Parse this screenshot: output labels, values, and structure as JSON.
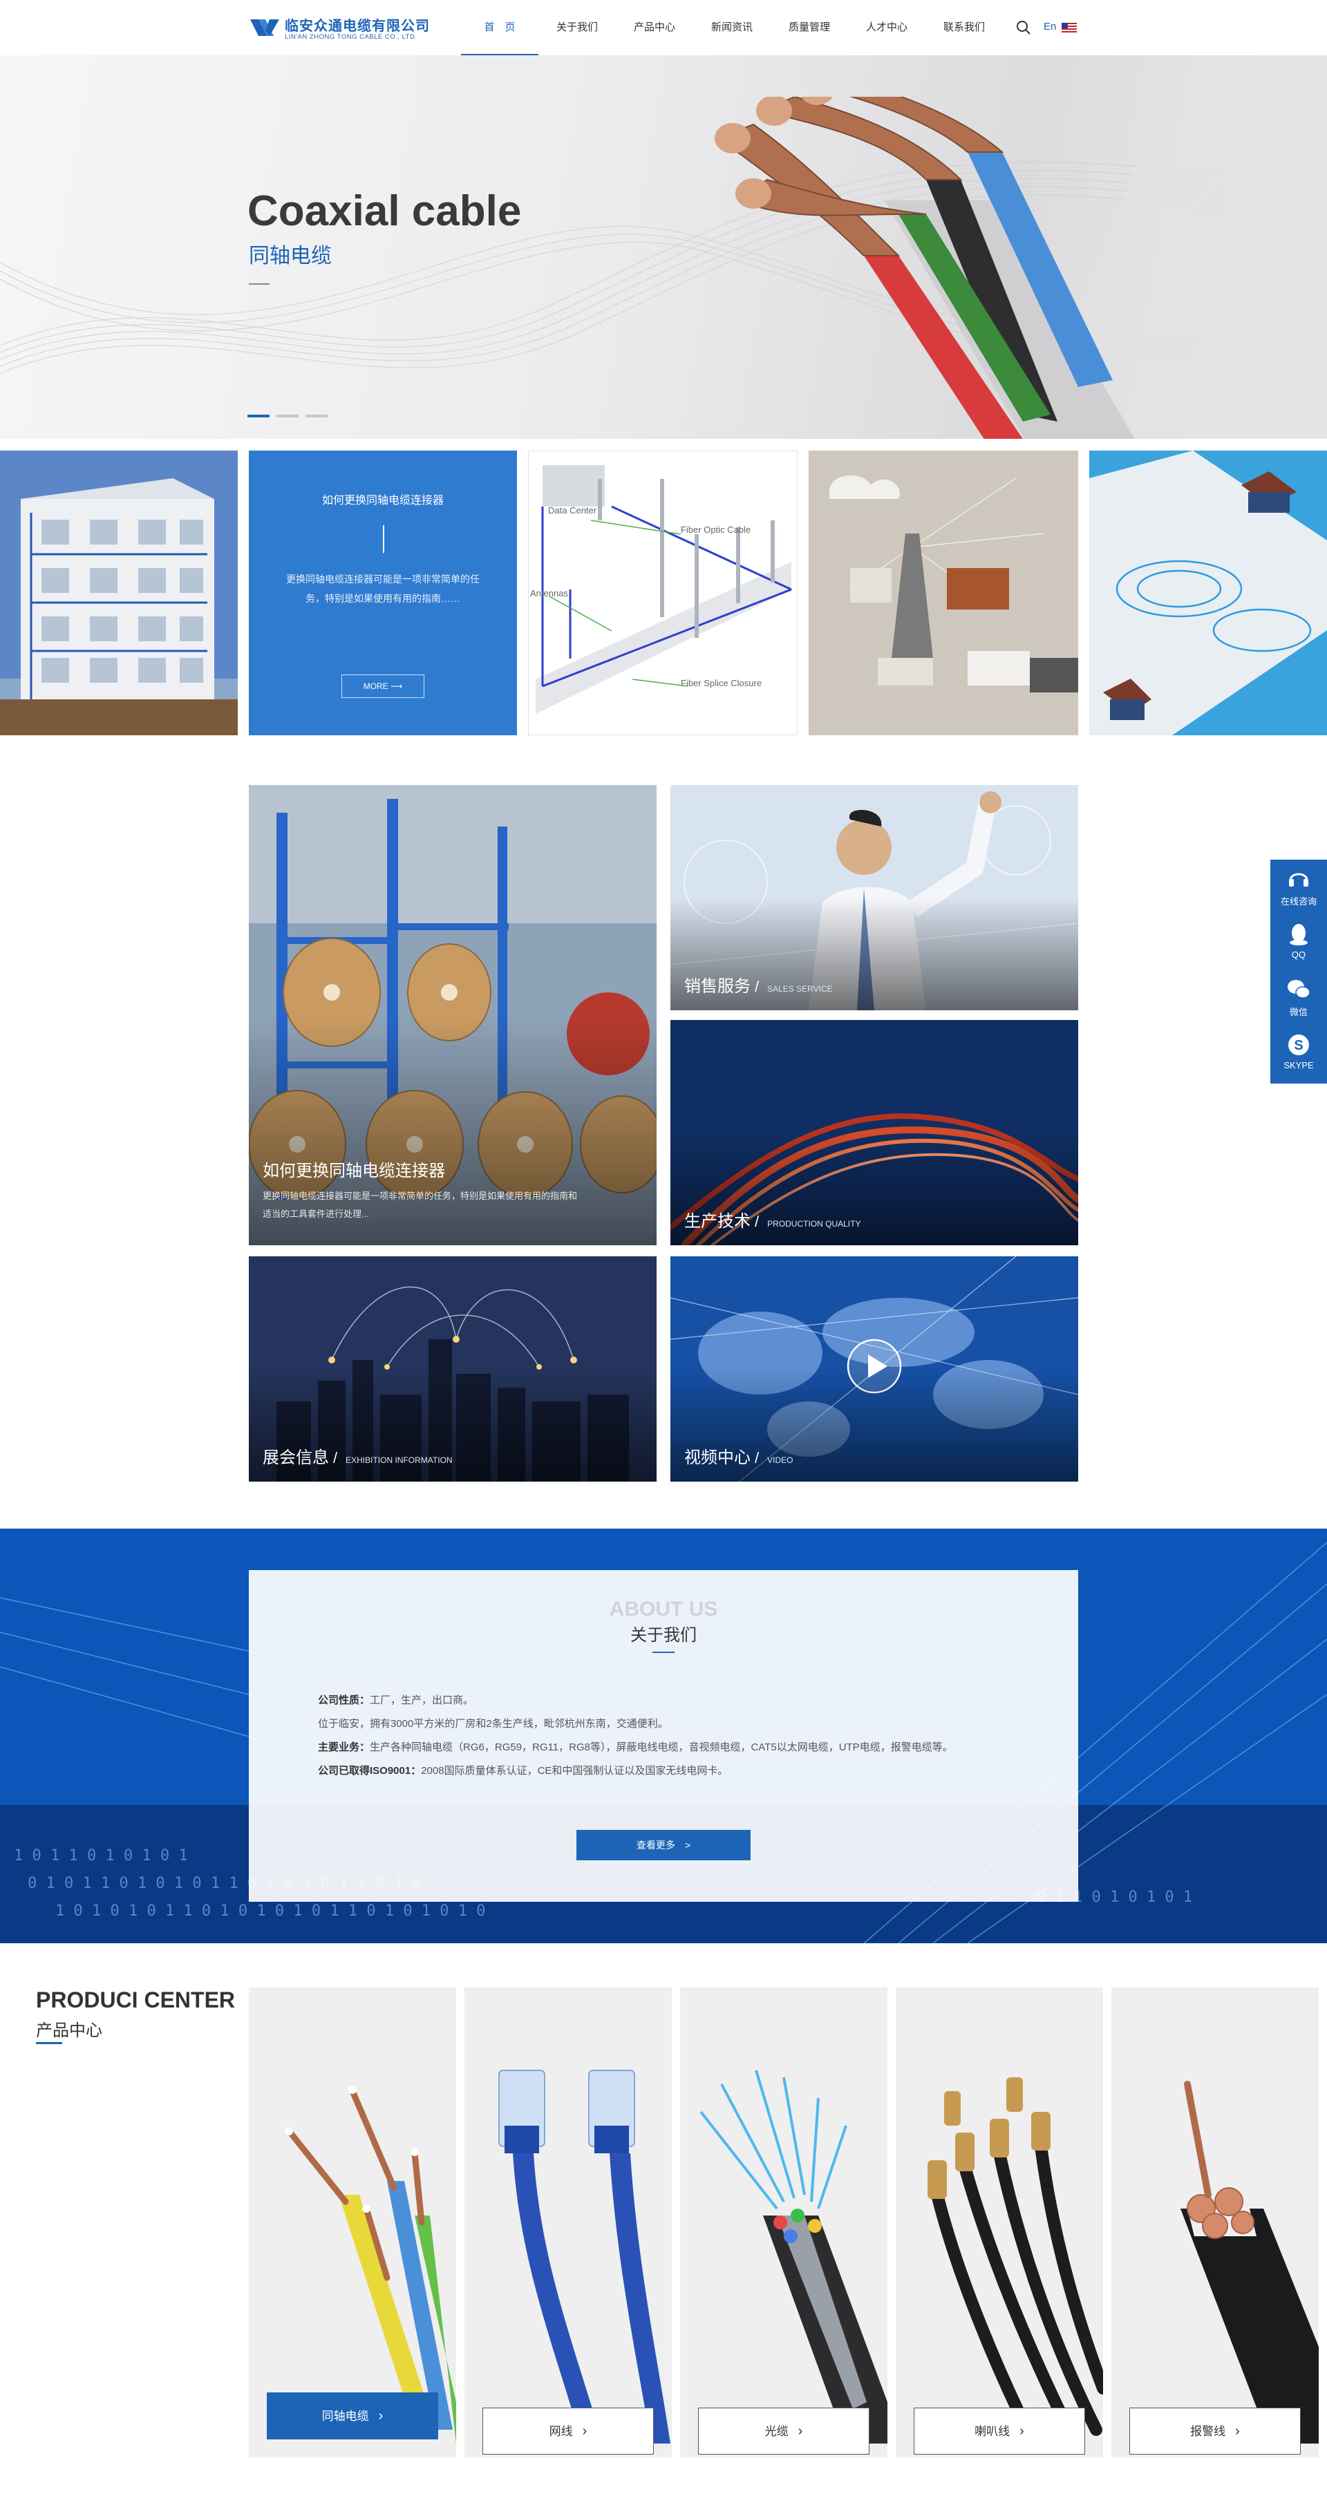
{
  "header": {
    "logo_cn": "临安众通电缆有限公司",
    "logo_en": "LIN'AN ZHONG TONG CABLE CO., LTD.",
    "nav": [
      "首　页",
      "关于我们",
      "产品中心",
      "新闻资讯",
      "质量管理",
      "人才中心",
      "联系我们"
    ],
    "active_nav": "首　页",
    "lang": "En"
  },
  "hero": {
    "title": "Coaxial cable",
    "subtitle": "同轴电缆",
    "slides": 3,
    "active_slide": 1
  },
  "strip": {
    "info_title": "如何更换同轴电缆连接器",
    "info_text": "更换同轴电缆连接器可能是一项非常简单的任务，特别是如果使用有用的指南……",
    "info_more": "MORE",
    "diagram_labels": [
      "Data Center",
      "Fiber Optic Cable",
      "Antennas",
      "Fiber Splice Closure"
    ]
  },
  "services": {
    "big": {
      "title": "如何更换同轴电缆连接器",
      "desc": "更换同轴电缆连接器可能是一项非常简单的任务，特别是如果使用有用的指南和适当的工具套件进行处理..."
    },
    "sales": {
      "cn": "销售服务",
      "en": "SALES SERVICE"
    },
    "production": {
      "cn": "生产技术",
      "en": "PRODUCTION QUALITY"
    },
    "exhibition": {
      "cn": "展会信息",
      "en": "EXHIBITION INFORMATION"
    },
    "video": {
      "cn": "视频中心",
      "en": "VIDEO"
    }
  },
  "float": {
    "items": [
      "在线咨询",
      "QQ",
      "微信",
      "SKYPE"
    ]
  },
  "about": {
    "en": "ABOUT US",
    "cn": "关于我们",
    "line1_label": "公司性质：",
    "line1": "工厂，生产，出口商。",
    "line2": "位于临安，拥有3000平方米的厂房和2条生产线，毗邻杭州东南，交通便利。",
    "line3_label": "主要业务：",
    "line3": "生产各种同轴电缆（RG6，RG59，RG11，RG8等），屏蔽电线电缆，音视频电缆，CAT5以太网电缆，UTP电缆，报警电缆等。",
    "line4_label": "公司已取得ISO9001：",
    "line4": "2008国际质量体系认证，CE和中国强制认证以及国家无线电网卡。",
    "button": "查看更多　>"
  },
  "products": {
    "en": "PRODUCI CENTER",
    "cn": "产品中心",
    "items": [
      "同轴电缆",
      "网线",
      "光缆",
      "喇叭线",
      "报警线"
    ],
    "active": "同轴电缆"
  },
  "colors": {
    "brand": "#1d64b7",
    "info_tile": "#2f7bd0"
  }
}
